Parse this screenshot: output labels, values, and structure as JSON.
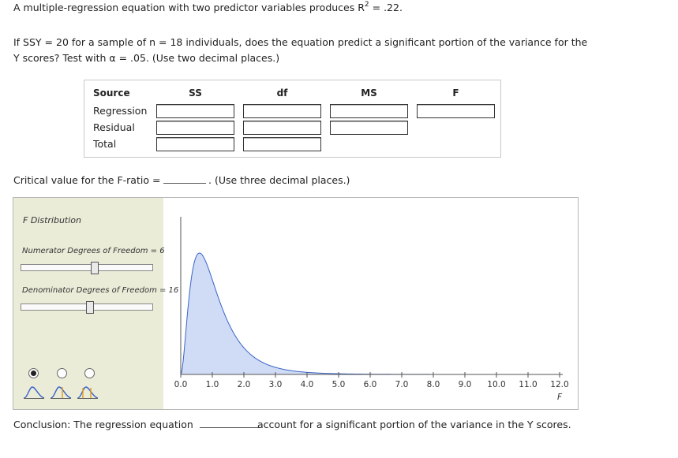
{
  "problem": {
    "intro_prefix": "A multiple-regression equation with two predictor variables produces R",
    "intro_sup": "2",
    "intro_suffix": " = .22.",
    "question_line1": "If SSY = 20 for a sample of n = 18 individuals, does the equation predict a significant portion of the variance for the",
    "question_line2": "Y scores? Test with α = .05. (Use two decimal places.)"
  },
  "table": {
    "headers": [
      "Source",
      "SS",
      "df",
      "MS",
      "F"
    ],
    "rows": [
      "Regression",
      "Residual",
      "Total"
    ]
  },
  "critical": {
    "label": "Critical value for the F-ratio =",
    "hint": ". (Use three decimal places.)"
  },
  "applet": {
    "title": "F Distribution",
    "numerator_label": "Numerator Degrees of Freedom = 6",
    "numerator_df": 6,
    "denominator_label": "Denominator Degrees of Freedom = 16",
    "denominator_df": 16,
    "selected_tail_option": 0,
    "x_ticks": [
      "0.0",
      "1.0",
      "2.0",
      "3.0",
      "4.0",
      "5.0",
      "6.0",
      "7.0",
      "8.0",
      "9.0",
      "10.0",
      "11.0",
      "12.0"
    ],
    "x_axis_label": "F",
    "curve_fill": "#d0dcf5",
    "curve_stroke": "#3a64c8"
  },
  "conclusion": {
    "prefix": "Conclusion: The regression equation",
    "suffix": "account for a significant portion of the variance in the Y scores."
  }
}
